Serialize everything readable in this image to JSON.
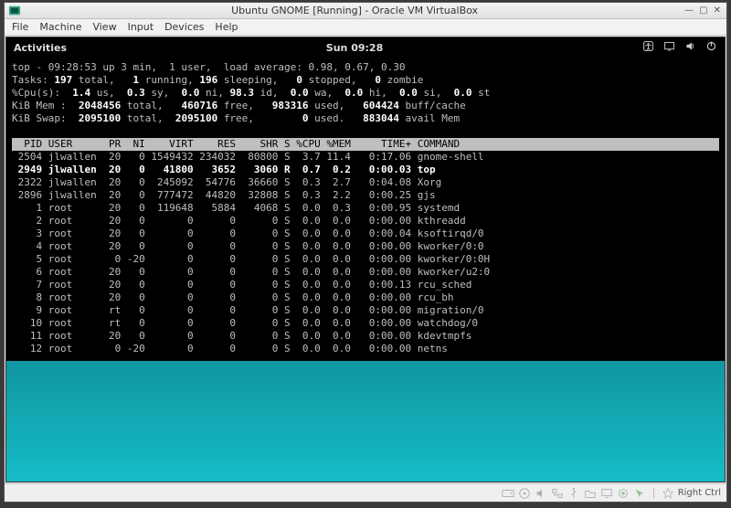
{
  "window": {
    "title": "Ubuntu GNOME [Running] - Oracle VM VirtualBox"
  },
  "menubar": [
    "File",
    "Machine",
    "View",
    "Input",
    "Devices",
    "Help"
  ],
  "gnomebar": {
    "activities": "Activities",
    "clock": "Sun 09:28"
  },
  "top": {
    "line1": "top - 09:28:53 up 3 min,  1 user,  load average: 0.98, 0.67, 0.30",
    "line2": "Tasks: 197 total,   1 running, 196 sleeping,   0 stopped,   0 zombie",
    "line3": "%Cpu(s):  1.4 us,  0.3 sy,  0.0 ni, 98.3 id,  0.0 wa,  0.0 hi,  0.0 si,  0.0 st",
    "line4": "KiB Mem :  2048456 total,   460716 free,   983316 used,   604424 buff/cache",
    "line5": "KiB Swap:  2095100 total,  2095100 free,        0 used.   883044 avail Mem",
    "header": "  PID USER      PR  NI    VIRT    RES    SHR S %CPU %MEM     TIME+ COMMAND    ",
    "processes": [
      {
        "pid": "2504",
        "user": "jlwallen",
        "pr": "20",
        "ni": "0",
        "virt": "1549432",
        "res": "234032",
        "shr": "80800",
        "s": "S",
        "cpu": "3.7",
        "mem": "11.4",
        "time": "0:17.06",
        "cmd": "gnome-shell",
        "hl": false
      },
      {
        "pid": "2949",
        "user": "jlwallen",
        "pr": "20",
        "ni": "0",
        "virt": "41800",
        "res": "3652",
        "shr": "3060",
        "s": "R",
        "cpu": "0.7",
        "mem": "0.2",
        "time": "0:00.03",
        "cmd": "top",
        "hl": true
      },
      {
        "pid": "2322",
        "user": "jlwallen",
        "pr": "20",
        "ni": "0",
        "virt": "245092",
        "res": "54776",
        "shr": "36660",
        "s": "S",
        "cpu": "0.3",
        "mem": "2.7",
        "time": "0:04.08",
        "cmd": "Xorg",
        "hl": false
      },
      {
        "pid": "2896",
        "user": "jlwallen",
        "pr": "20",
        "ni": "0",
        "virt": "777472",
        "res": "44820",
        "shr": "32808",
        "s": "S",
        "cpu": "0.3",
        "mem": "2.2",
        "time": "0:00.25",
        "cmd": "gjs",
        "hl": false
      },
      {
        "pid": "1",
        "user": "root",
        "pr": "20",
        "ni": "0",
        "virt": "119648",
        "res": "5884",
        "shr": "4068",
        "s": "S",
        "cpu": "0.0",
        "mem": "0.3",
        "time": "0:00.95",
        "cmd": "systemd",
        "hl": false
      },
      {
        "pid": "2",
        "user": "root",
        "pr": "20",
        "ni": "0",
        "virt": "0",
        "res": "0",
        "shr": "0",
        "s": "S",
        "cpu": "0.0",
        "mem": "0.0",
        "time": "0:00.00",
        "cmd": "kthreadd",
        "hl": false
      },
      {
        "pid": "3",
        "user": "root",
        "pr": "20",
        "ni": "0",
        "virt": "0",
        "res": "0",
        "shr": "0",
        "s": "S",
        "cpu": "0.0",
        "mem": "0.0",
        "time": "0:00.04",
        "cmd": "ksoftirqd/0",
        "hl": false
      },
      {
        "pid": "4",
        "user": "root",
        "pr": "20",
        "ni": "0",
        "virt": "0",
        "res": "0",
        "shr": "0",
        "s": "S",
        "cpu": "0.0",
        "mem": "0.0",
        "time": "0:00.00",
        "cmd": "kworker/0:0",
        "hl": false
      },
      {
        "pid": "5",
        "user": "root",
        "pr": "0",
        "ni": "-20",
        "virt": "0",
        "res": "0",
        "shr": "0",
        "s": "S",
        "cpu": "0.0",
        "mem": "0.0",
        "time": "0:00.00",
        "cmd": "kworker/0:0H",
        "hl": false
      },
      {
        "pid": "6",
        "user": "root",
        "pr": "20",
        "ni": "0",
        "virt": "0",
        "res": "0",
        "shr": "0",
        "s": "S",
        "cpu": "0.0",
        "mem": "0.0",
        "time": "0:00.00",
        "cmd": "kworker/u2:0",
        "hl": false
      },
      {
        "pid": "7",
        "user": "root",
        "pr": "20",
        "ni": "0",
        "virt": "0",
        "res": "0",
        "shr": "0",
        "s": "S",
        "cpu": "0.0",
        "mem": "0.0",
        "time": "0:00.13",
        "cmd": "rcu_sched",
        "hl": false
      },
      {
        "pid": "8",
        "user": "root",
        "pr": "20",
        "ni": "0",
        "virt": "0",
        "res": "0",
        "shr": "0",
        "s": "S",
        "cpu": "0.0",
        "mem": "0.0",
        "time": "0:00.00",
        "cmd": "rcu_bh",
        "hl": false
      },
      {
        "pid": "9",
        "user": "root",
        "pr": "rt",
        "ni": "0",
        "virt": "0",
        "res": "0",
        "shr": "0",
        "s": "S",
        "cpu": "0.0",
        "mem": "0.0",
        "time": "0:00.00",
        "cmd": "migration/0",
        "hl": false
      },
      {
        "pid": "10",
        "user": "root",
        "pr": "rt",
        "ni": "0",
        "virt": "0",
        "res": "0",
        "shr": "0",
        "s": "S",
        "cpu": "0.0",
        "mem": "0.0",
        "time": "0:00.00",
        "cmd": "watchdog/0",
        "hl": false
      },
      {
        "pid": "11",
        "user": "root",
        "pr": "20",
        "ni": "0",
        "virt": "0",
        "res": "0",
        "shr": "0",
        "s": "S",
        "cpu": "0.0",
        "mem": "0.0",
        "time": "0:00.00",
        "cmd": "kdevtmpfs",
        "hl": false
      },
      {
        "pid": "12",
        "user": "root",
        "pr": "0",
        "ni": "-20",
        "virt": "0",
        "res": "0",
        "shr": "0",
        "s": "S",
        "cpu": "0.0",
        "mem": "0.0",
        "time": "0:00.00",
        "cmd": "netns",
        "hl": false
      }
    ]
  },
  "statusbar": {
    "hostkey": "Right Ctrl"
  }
}
